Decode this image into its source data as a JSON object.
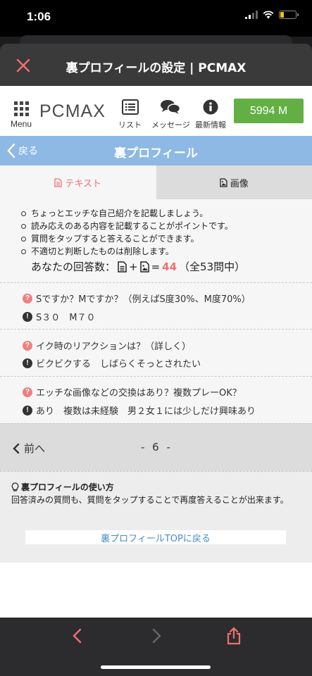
{
  "status_bar": {
    "time": "1:06",
    "battery_level": 0.25
  },
  "nav_header": {
    "title": "裏プロフィールの設定 | PCMAX",
    "close_icon": "close-icon"
  },
  "site_header": {
    "menu_label": "Menu",
    "logo": "PCMAX",
    "nav": [
      {
        "label": "リスト",
        "icon": "list-icon"
      },
      {
        "label": "メッセージ",
        "icon": "chat-bubbles-icon"
      },
      {
        "label": "最新情報",
        "icon": "info-icon"
      }
    ],
    "points": "5994 M",
    "accent": "#62b043"
  },
  "title_bar": {
    "back_label": "戻る",
    "title": "裏プロフィール",
    "color": "#8db9e4"
  },
  "tabs": [
    {
      "label": "テキスト",
      "icon": "document-icon",
      "active": true
    },
    {
      "label": "画像",
      "icon": "image-file-icon",
      "active": false
    }
  ],
  "info": {
    "bullets": [
      "ちょっとエッチな自己紹介を記載しましょう。",
      "読み応えのある内容を記載することがポイントです。",
      "質問をタップすると答えることができます。",
      "不適切と判断したものは削除します。"
    ],
    "answer_label": "あなたの回答数：",
    "plus": "+",
    "equals": "=",
    "answer_count": "44",
    "total_label": "（全53問中）"
  },
  "qa_items": [
    {
      "question": "Sですか？Mですか？（例えばS度30%、M度70%）",
      "answer": "S３０　M７０"
    },
    {
      "question": "イク時のリアクションは？（詳しく）",
      "answer": "ビクビクする　しばらくそっとされたい"
    },
    {
      "question": "エッチな画像などの交換はあり？複数プレーOK？",
      "answer": "あり　複数は未経験　男２女１には少しだけ興味あり"
    }
  ],
  "pager": {
    "prev_label": "前へ",
    "page": "- 6 -"
  },
  "usage": {
    "title": "裏プロフィールの使い方",
    "description": "回答済みの質問も、質問をタップすることで再度答えることが出来ます。",
    "top_link": "裏プロフィールTOPに戻る"
  },
  "bottom_bar": {
    "icons": [
      "back-arrow-icon",
      "forward-arrow-icon",
      "share-icon"
    ]
  }
}
